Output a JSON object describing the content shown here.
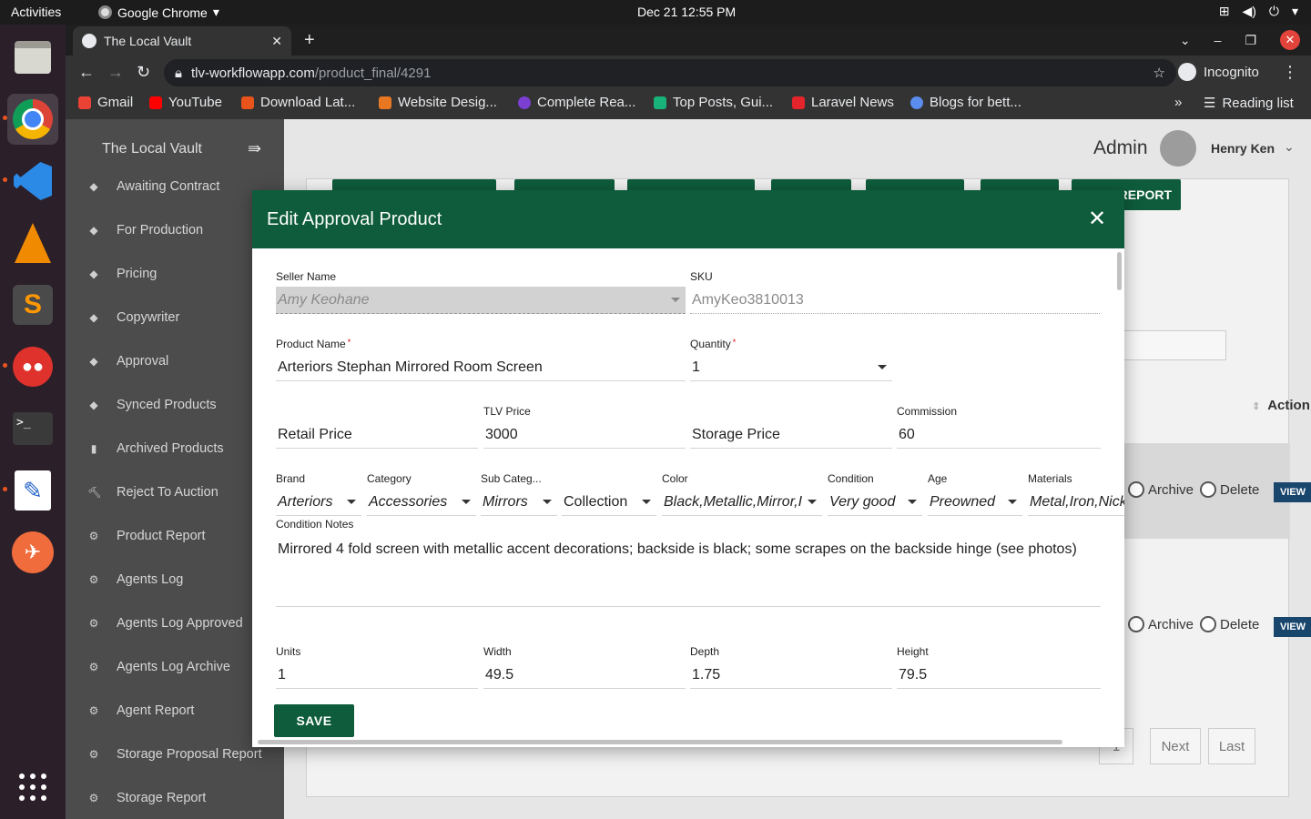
{
  "system": {
    "activities": "Activities",
    "app_name": "Google Chrome",
    "clock": "Dec 21  12:55 PM"
  },
  "browser": {
    "tab_title": "The Local Vault",
    "url_host": "tlv-workflowapp.com",
    "url_path": "/product_final/4291",
    "incognito_label": "Incognito",
    "bookmarks": [
      {
        "label": "Gmail",
        "color": "#ea4335"
      },
      {
        "label": "YouTube",
        "color": "#ff0000"
      },
      {
        "label": "Download Lat...",
        "color": "#e8541c"
      },
      {
        "label": "Website Desig...",
        "color": "#e87722"
      },
      {
        "label": "Complete Rea...",
        "color": "#7b3fd1"
      },
      {
        "label": "Top Posts, Gui...",
        "color": "#19b27b"
      },
      {
        "label": "Laravel News",
        "color": "#e3242b"
      },
      {
        "label": "Blogs for bett...",
        "color": "#5b8def"
      }
    ],
    "reading_list": "Reading list"
  },
  "sidebar": {
    "brand": "The Local Vault",
    "items": [
      {
        "label": "Awaiting Contract",
        "icon": "layers-icon"
      },
      {
        "label": "For Production",
        "icon": "layers-icon"
      },
      {
        "label": "Pricing",
        "icon": "layers-icon"
      },
      {
        "label": "Copywriter",
        "icon": "layers-icon"
      },
      {
        "label": "Approval",
        "icon": "layers-icon"
      },
      {
        "label": "Synced Products",
        "icon": "layers-icon"
      },
      {
        "label": "Archived Products",
        "icon": "trash-icon"
      },
      {
        "label": "Reject To Auction",
        "icon": "gavel-icon"
      },
      {
        "label": "Product Report",
        "icon": "gear-icon"
      },
      {
        "label": "Agents Log",
        "icon": "gear-icon"
      },
      {
        "label": "Agents Log Approved",
        "icon": "gear-icon"
      },
      {
        "label": "Agents Log Archive",
        "icon": "gear-icon"
      },
      {
        "label": "Agent Report",
        "icon": "gear-icon"
      },
      {
        "label": "Storage Proposal Report",
        "icon": "gear-icon"
      },
      {
        "label": "Storage Report",
        "icon": "gear-icon"
      }
    ]
  },
  "header": {
    "role": "Admin",
    "user_name": "Henry Ken"
  },
  "background": {
    "report_button": "REPORT",
    "action_header": "Action",
    "archive_label": "Archive",
    "delete_label": "Delete",
    "view_label": "VIEW",
    "pager": {
      "page": "1",
      "next": "Next",
      "last": "Last"
    }
  },
  "modal": {
    "title": "Edit Approval Product",
    "seller_name_label": "Seller Name",
    "seller_name_value": "Amy Keohane",
    "sku_label": "SKU",
    "sku_value": "AmyKeo3810013",
    "product_name_label": "Product Name",
    "product_name_value": "Arteriors Stephan Mirrored Room Screen",
    "quantity_label": "Quantity",
    "quantity_value": "1",
    "retail_price_placeholder": "Retail Price",
    "tlv_price_label": "TLV Price",
    "tlv_price_value": "3000",
    "storage_price_placeholder": "Storage Price",
    "commission_label": "Commission",
    "commission_value": "60",
    "brand_label": "Brand",
    "brand_value": "Arteriors",
    "category_label": "Category",
    "category_value": "Accessories",
    "subcategory_label": "Sub Categ...",
    "subcategory_value": "Mirrors",
    "collection_placeholder": "Collection",
    "color_label": "Color",
    "color_value": "Black,Metallic,Mirror,I",
    "condition_label": "Condition",
    "condition_value": "Very good",
    "age_label": "Age",
    "age_value": "Preowned",
    "materials_label": "Materials",
    "materials_value": "Metal,Iron,Nicke",
    "condition_notes_label": "Condition Notes",
    "condition_notes_value": "Mirrored 4 fold screen with metallic accent decorations; backside is black; some scrapes on the backside hinge (see photos)",
    "units_label": "Units",
    "units_value": "1",
    "width_label": "Width",
    "width_value": "49.5",
    "depth_label": "Depth",
    "depth_value": "1.75",
    "height_label": "Height",
    "height_value": "79.5",
    "save_label": "SAVE"
  }
}
